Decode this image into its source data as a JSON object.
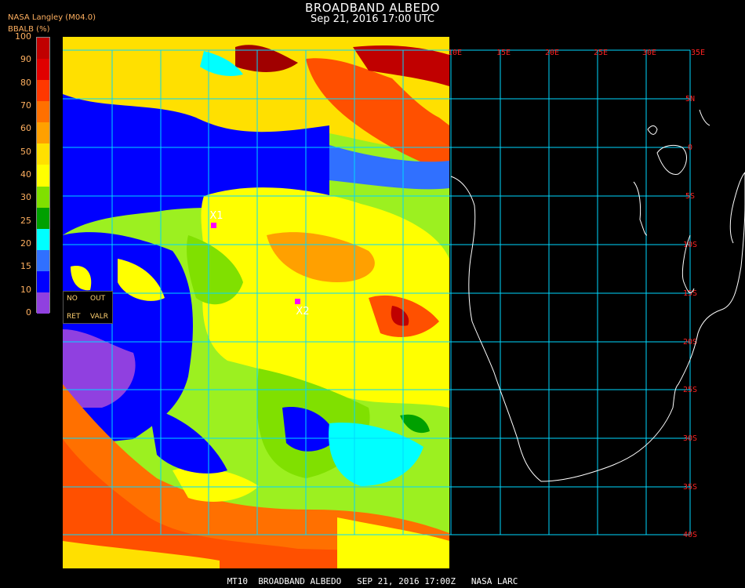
{
  "header": {
    "title": "BROADBAND ALBEDO",
    "subtitle": "Sep 21, 2016 17:00 UTC",
    "organization": "NASA Langley (M04.0)"
  },
  "colorbar": {
    "title": "BBALB (%)",
    "ticks": [
      "100",
      "90",
      "80",
      "70",
      "60",
      "50",
      "40",
      "30",
      "25",
      "20",
      "15",
      "10",
      "0"
    ],
    "colors": [
      "#c00000",
      "#e00000",
      "#ff3800",
      "#ff7000",
      "#ffa000",
      "#ffe000",
      "#ffff00",
      "#80e000",
      "#00a000",
      "#00ffff",
      "#3070ff",
      "#0000ff",
      "#9040e0"
    ]
  },
  "map": {
    "longitude_labels": [
      "10E",
      "15E",
      "20E",
      "25E",
      "30E",
      "35E"
    ],
    "latitude_labels": [
      "5N",
      "0",
      "5S",
      "10S",
      "15S",
      "20S",
      "25S",
      "30S",
      "35S",
      "40S"
    ],
    "grid_color": "#00d8ff",
    "label_color": "#ff2222",
    "coast_color": "#ffffff",
    "markers": [
      {
        "label": "X1",
        "color": "#ff00ff"
      },
      {
        "label": "X2",
        "color": "#ff00ff"
      }
    ]
  },
  "controls": {
    "no": "NO",
    "out": "OUT",
    "ret": "RET",
    "valr": "VALR"
  },
  "footer": "MT10  BROADBAND ALBEDO   SEP 21, 2016 17:00Z   NASA LARC"
}
